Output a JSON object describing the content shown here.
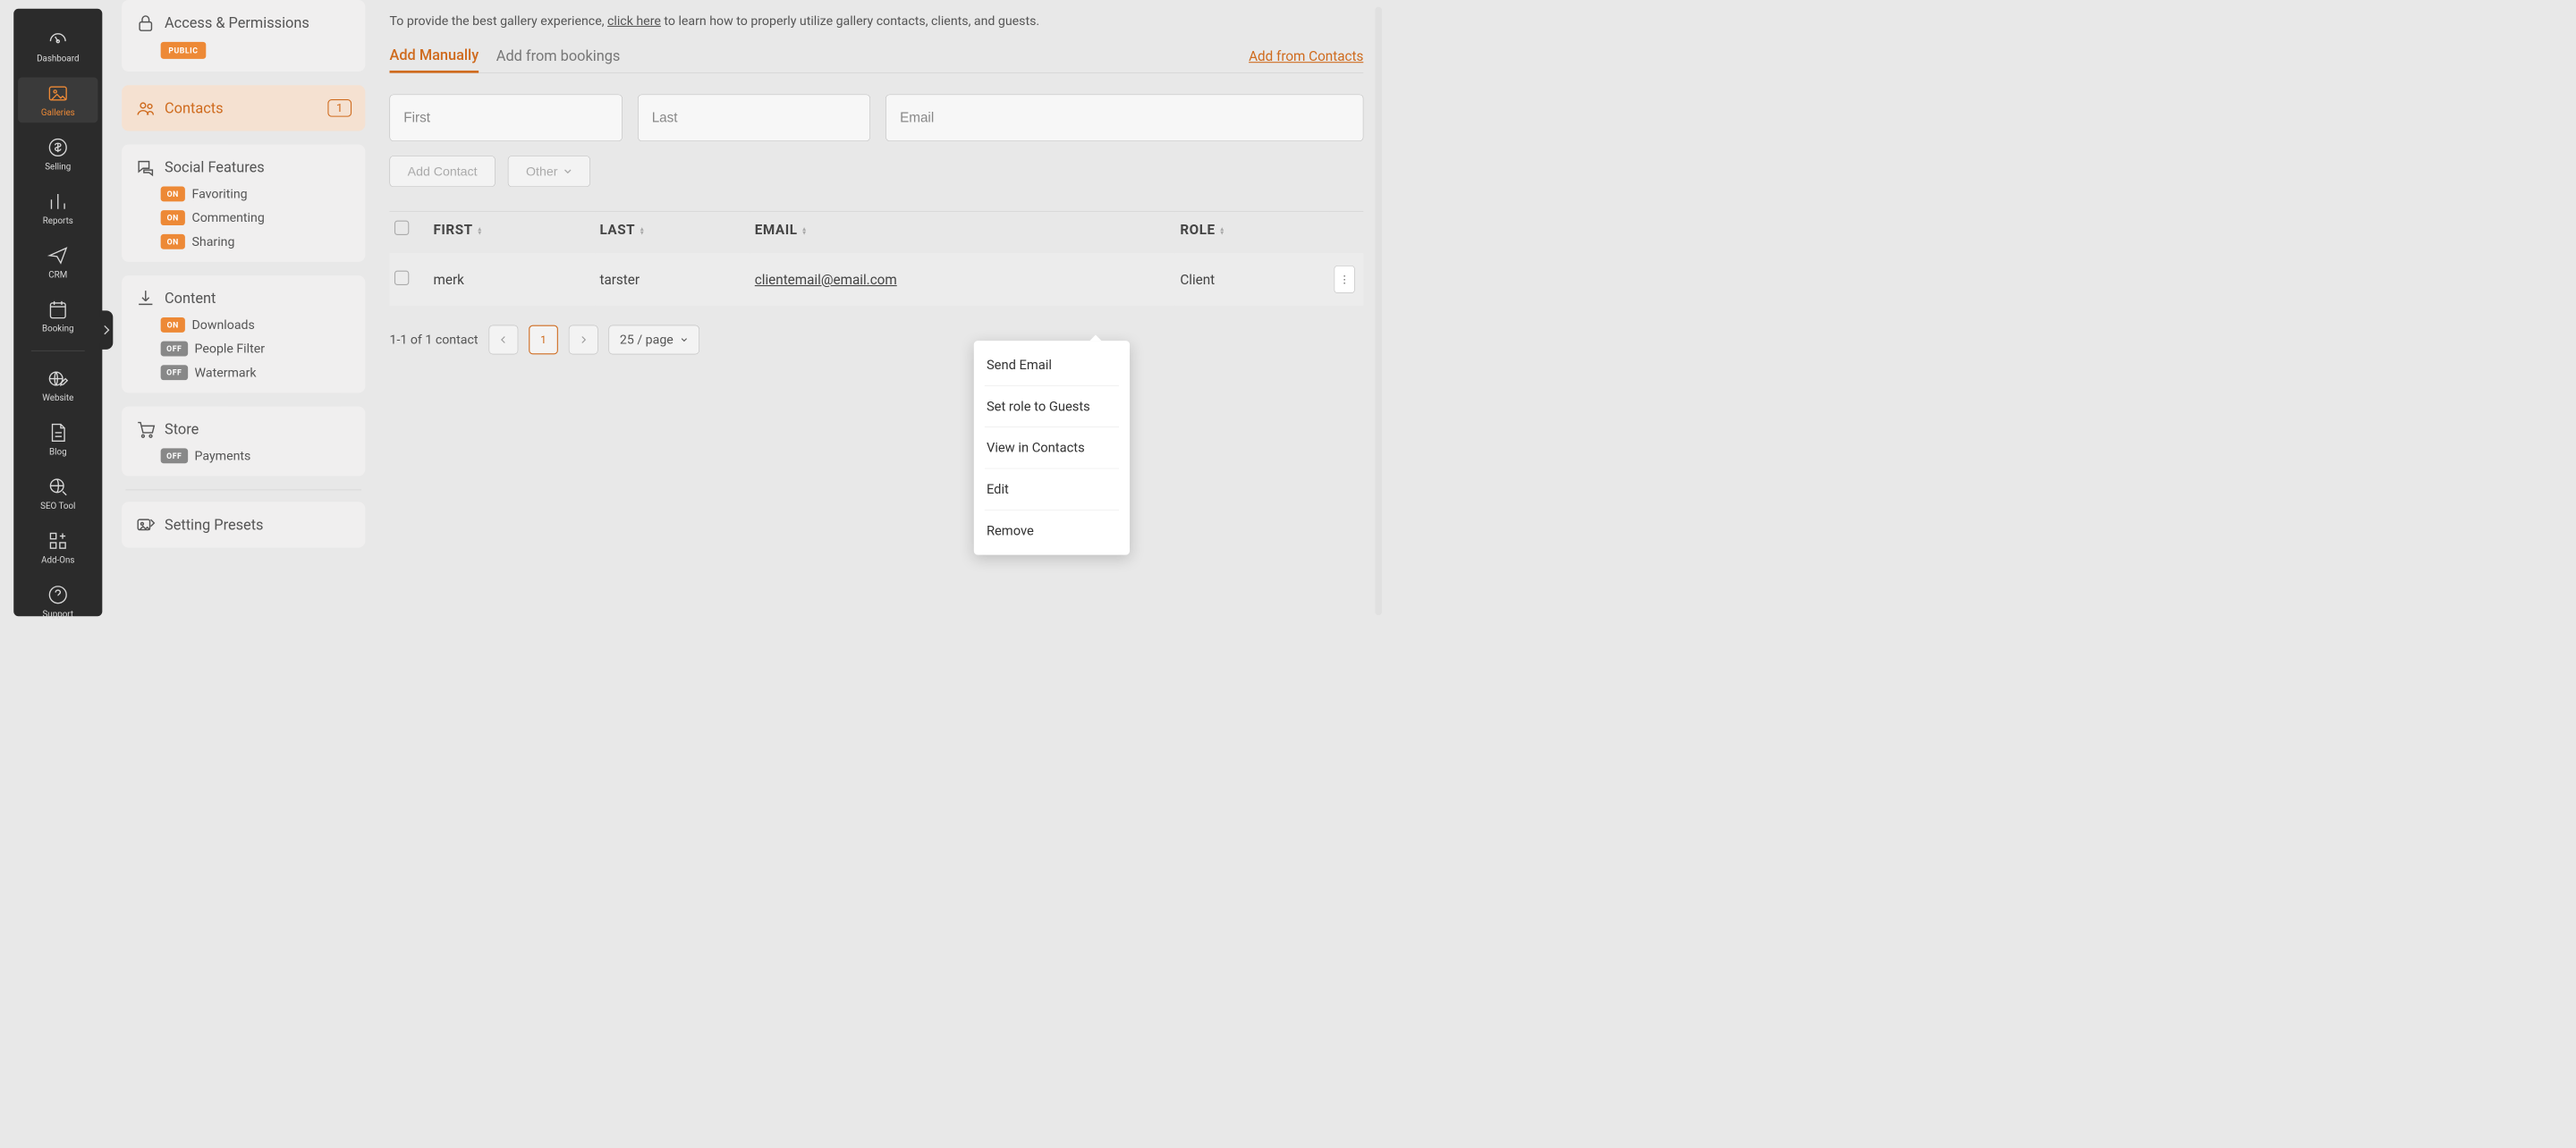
{
  "nav": {
    "items": [
      {
        "key": "dashboard",
        "label": "Dashboard"
      },
      {
        "key": "galleries",
        "label": "Galleries"
      },
      {
        "key": "selling",
        "label": "Selling"
      },
      {
        "key": "reports",
        "label": "Reports"
      },
      {
        "key": "crm",
        "label": "CRM"
      },
      {
        "key": "booking",
        "label": "Booking"
      },
      {
        "key": "website",
        "label": "Website"
      },
      {
        "key": "blog",
        "label": "Blog"
      },
      {
        "key": "seo",
        "label": "SEO Tool"
      },
      {
        "key": "addons",
        "label": "Add-Ons"
      },
      {
        "key": "support",
        "label": "Support"
      }
    ]
  },
  "settings": {
    "access": {
      "title": "Access & Permissions",
      "badge": "PUBLIC"
    },
    "contacts": {
      "title": "Contacts",
      "count": "1"
    },
    "social": {
      "title": "Social Features",
      "rows": [
        {
          "state": "ON",
          "label": "Favoriting"
        },
        {
          "state": "ON",
          "label": "Commenting"
        },
        {
          "state": "ON",
          "label": "Sharing"
        }
      ]
    },
    "content": {
      "title": "Content",
      "rows": [
        {
          "state": "ON",
          "label": "Downloads"
        },
        {
          "state": "OFF",
          "label": "People Filter"
        },
        {
          "state": "OFF",
          "label": "Watermark"
        }
      ]
    },
    "store": {
      "title": "Store",
      "rows": [
        {
          "state": "OFF",
          "label": "Payments"
        }
      ]
    },
    "presets": {
      "title": "Setting Presets"
    }
  },
  "main": {
    "intro_prefix": "To provide the best gallery experience, ",
    "intro_link": "click here",
    "intro_suffix": " to learn how to properly utilize gallery contacts, clients, and guests.",
    "tabs": {
      "manual": "Add Manually",
      "bookings": "Add from bookings",
      "from_contacts": "Add from Contacts"
    },
    "inputs": {
      "first_ph": "First",
      "last_ph": "Last",
      "email_ph": "Email"
    },
    "buttons": {
      "add_contact": "Add Contact",
      "other": "Other"
    },
    "table": {
      "headers": {
        "first": "FIRST",
        "last": "LAST",
        "email": "EMAIL",
        "role": "ROLE"
      },
      "rows": [
        {
          "first": "merk",
          "last": "tarster",
          "email": "clientemail@email.com",
          "role": "Client"
        }
      ]
    },
    "pager": {
      "summary": "1-1 of 1 contact",
      "page": "1",
      "perpage": "25 / page"
    },
    "dropdown": {
      "send_email": "Send Email",
      "set_role": "Set role to Guests",
      "view": "View in Contacts",
      "edit": "Edit",
      "remove": "Remove"
    }
  }
}
